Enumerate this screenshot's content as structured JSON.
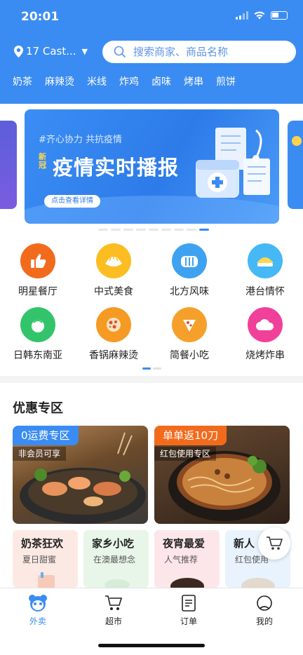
{
  "status_bar": {
    "time": "20:01"
  },
  "header": {
    "location": "17 Cast...",
    "search_placeholder": "搜索商家、商品名称",
    "categories": [
      "奶茶",
      "麻辣烫",
      "米线",
      "炸鸡",
      "卤味",
      "烤串",
      "煎饼"
    ]
  },
  "banner": {
    "tag": "#齐心协力 共抗疫情",
    "title_small": "新冠",
    "title": "疫情实时播报",
    "button": "点击查看详情",
    "page_count": 9,
    "active_page": 9
  },
  "grid": {
    "items": [
      {
        "label": "明星餐厅",
        "icon": "thumbs-up-icon",
        "color": "#f26b1d"
      },
      {
        "label": "中式美食",
        "icon": "dumpling-icon",
        "color": "#fbbd21"
      },
      {
        "label": "北方风味",
        "icon": "bread-icon",
        "color": "#3ea2f0"
      },
      {
        "label": "港台情怀",
        "icon": "bun-icon",
        "color": "#46b8f5"
      },
      {
        "label": "日韩东南亚",
        "icon": "coconut-icon",
        "color": "#33c46b"
      },
      {
        "label": "香锅麻辣烫",
        "icon": "pot-icon",
        "color": "#f59a23"
      },
      {
        "label": "简餐小吃",
        "icon": "pizza-icon",
        "color": "#f6a02c"
      },
      {
        "label": "烧烤炸串",
        "icon": "cloud-icon",
        "color": "#f0409a"
      }
    ]
  },
  "section": {
    "title": "优惠专区"
  },
  "promos": [
    {
      "tag": "0运费专区",
      "sub": "非会员可享",
      "tag_color": "#3b8cf2"
    },
    {
      "tag": "单单返10刀",
      "sub": "红包使用专区",
      "tag_color": "#f26b1d"
    }
  ],
  "small_cards": [
    {
      "title": "奶茶狂欢",
      "sub": "夏日甜蜜",
      "bg": "#fde9e4"
    },
    {
      "title": "家乡小吃",
      "sub": "在澳最想念",
      "bg": "#e8f6ea"
    },
    {
      "title": "夜宵最爱",
      "sub": "人气推荐",
      "bg": "#fde6ea"
    },
    {
      "title": "新人",
      "sub": "红包使用",
      "bg": "#e9f3fd"
    }
  ],
  "tabs": [
    {
      "label": "外卖",
      "icon": "panda-icon",
      "active": true
    },
    {
      "label": "超市",
      "icon": "cart-icon",
      "active": false
    },
    {
      "label": "订单",
      "icon": "order-icon",
      "active": false
    },
    {
      "label": "我的",
      "icon": "user-icon",
      "active": false
    }
  ],
  "colors": {
    "primary": "#3b8cf2"
  }
}
